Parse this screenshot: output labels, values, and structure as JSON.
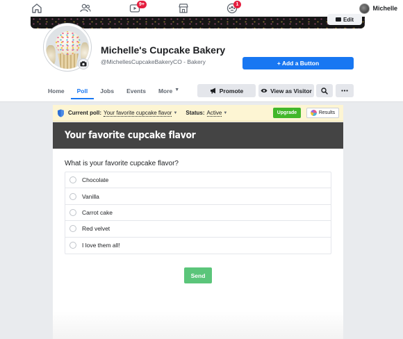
{
  "topnav": {
    "icons": [
      {
        "name": "home-icon"
      },
      {
        "name": "friends-icon"
      },
      {
        "name": "watch-icon",
        "badge": "9+"
      },
      {
        "name": "marketplace-icon"
      },
      {
        "name": "groups-icon",
        "badge": "1"
      }
    ],
    "user_name": "Michelle"
  },
  "header": {
    "edit_label": "Edit",
    "page_name": "Michelle's Cupcake Bakery",
    "page_handle": "@MichellesCupcakeBakeryCO - Bakery",
    "add_button_label": "+ Add a Button",
    "tabs": [
      {
        "label": "Home"
      },
      {
        "label": "Poll",
        "active": true
      },
      {
        "label": "Jobs"
      },
      {
        "label": "Events"
      },
      {
        "label": "More"
      }
    ],
    "actions": {
      "promote": "Promote",
      "view_as_visitor": "View as Visitor"
    }
  },
  "poll_bar": {
    "current_poll_label": "Current poll:",
    "current_poll_value": "Your favorite cupcake flavor",
    "status_label": "Status:",
    "status_value": "Active",
    "upgrade_label": "Upgrade",
    "results_label": "Results"
  },
  "poll": {
    "title": "Your favorite cupcake flavor",
    "question": "What is your favorite cupcake flavor?",
    "options": [
      "Chocolate",
      "Vanilla",
      "Carrot cake",
      "Red velvet",
      "I love them all!"
    ],
    "send_label": "Send"
  },
  "colors": {
    "brand_blue": "#1877f2",
    "upgrade_green": "#42b72a",
    "send_green": "#5bc57a",
    "poll_bar_bg": "#fdf5d3",
    "title_bar_bg": "#444444",
    "badge_red": "#e41e3f"
  }
}
